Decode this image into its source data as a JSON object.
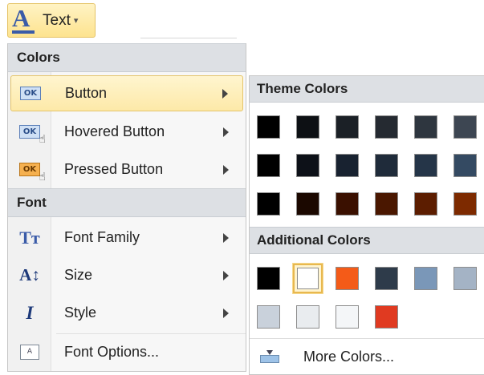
{
  "ribbon": {
    "button_icon_glyph": "A",
    "button_label": "Text",
    "dropdown_caret": "▾"
  },
  "menu": {
    "sections": [
      {
        "header": "Colors",
        "items": [
          {
            "label": "Button",
            "icon": "ok-button-icon",
            "icon_text": "OK",
            "has_submenu": true,
            "selected": true
          },
          {
            "label": "Hovered Button",
            "icon": "ok-button-hover-icon",
            "icon_text": "OK",
            "has_submenu": true
          },
          {
            "label": "Pressed Button",
            "icon": "ok-button-pressed-icon",
            "icon_text": "OK",
            "has_submenu": true
          }
        ]
      },
      {
        "header": "Font",
        "items": [
          {
            "label": "Font Family",
            "icon": "font-family-icon",
            "icon_text": "Tт",
            "has_submenu": true
          },
          {
            "label": "Size",
            "icon": "font-size-icon",
            "icon_text": "A↕",
            "has_submenu": true
          },
          {
            "label": "Style",
            "icon": "italic-style-icon",
            "icon_text": "I",
            "has_submenu": true
          },
          {
            "label": "Font Options...",
            "icon": "font-options-icon",
            "icon_text": "A",
            "has_submenu": false
          }
        ]
      }
    ]
  },
  "submenu": {
    "theme_header": "Theme Colors",
    "theme_rows": [
      [
        "#000000",
        "#0d1014",
        "#1b2026",
        "#252a31",
        "#2e363f",
        "#3d4652"
      ],
      [
        "#000000",
        "#0d1118",
        "#182230",
        "#1f2b3a",
        "#253548",
        "#344a62"
      ],
      [
        "#000000",
        "#1b0800",
        "#3a1000",
        "#4a1700",
        "#5c1d00",
        "#7d2a00"
      ]
    ],
    "additional_header": "Additional Colors",
    "additional_rows": [
      [
        "#000000",
        "#ffffff",
        "#f45b18",
        "#2e3b4a",
        "#7a97b8",
        "#a4b3c5"
      ],
      [
        "#c9d1db",
        "#e9ecef",
        "#f4f6f8",
        "#e03a21"
      ]
    ],
    "selected_additional_index": 1,
    "more_colors_label": "More Colors..."
  }
}
